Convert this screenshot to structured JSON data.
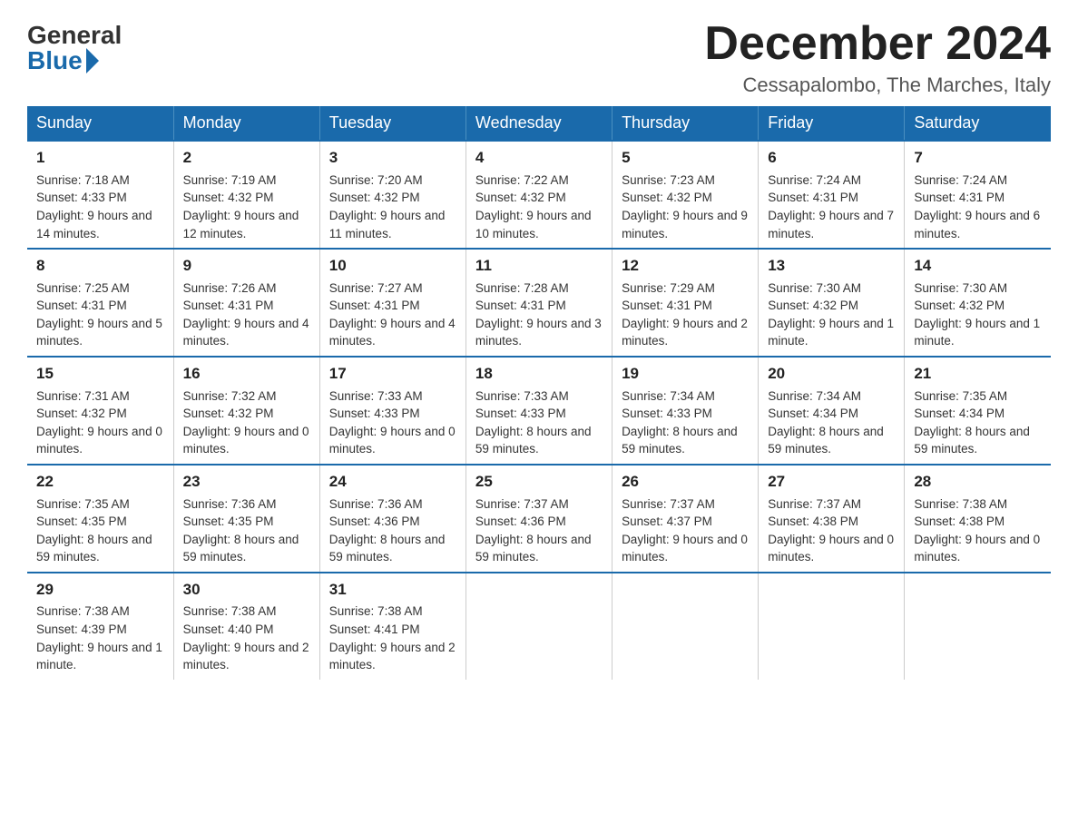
{
  "header": {
    "logo_general": "General",
    "logo_blue": "Blue",
    "month_year": "December 2024",
    "location": "Cessapalombo, The Marches, Italy"
  },
  "weekdays": [
    "Sunday",
    "Monday",
    "Tuesday",
    "Wednesday",
    "Thursday",
    "Friday",
    "Saturday"
  ],
  "weeks": [
    [
      {
        "day": "1",
        "sunrise": "7:18 AM",
        "sunset": "4:33 PM",
        "daylight": "9 hours and 14 minutes."
      },
      {
        "day": "2",
        "sunrise": "7:19 AM",
        "sunset": "4:32 PM",
        "daylight": "9 hours and 12 minutes."
      },
      {
        "day": "3",
        "sunrise": "7:20 AM",
        "sunset": "4:32 PM",
        "daylight": "9 hours and 11 minutes."
      },
      {
        "day": "4",
        "sunrise": "7:22 AM",
        "sunset": "4:32 PM",
        "daylight": "9 hours and 10 minutes."
      },
      {
        "day": "5",
        "sunrise": "7:23 AM",
        "sunset": "4:32 PM",
        "daylight": "9 hours and 9 minutes."
      },
      {
        "day": "6",
        "sunrise": "7:24 AM",
        "sunset": "4:31 PM",
        "daylight": "9 hours and 7 minutes."
      },
      {
        "day": "7",
        "sunrise": "7:24 AM",
        "sunset": "4:31 PM",
        "daylight": "9 hours and 6 minutes."
      }
    ],
    [
      {
        "day": "8",
        "sunrise": "7:25 AM",
        "sunset": "4:31 PM",
        "daylight": "9 hours and 5 minutes."
      },
      {
        "day": "9",
        "sunrise": "7:26 AM",
        "sunset": "4:31 PM",
        "daylight": "9 hours and 4 minutes."
      },
      {
        "day": "10",
        "sunrise": "7:27 AM",
        "sunset": "4:31 PM",
        "daylight": "9 hours and 4 minutes."
      },
      {
        "day": "11",
        "sunrise": "7:28 AM",
        "sunset": "4:31 PM",
        "daylight": "9 hours and 3 minutes."
      },
      {
        "day": "12",
        "sunrise": "7:29 AM",
        "sunset": "4:31 PM",
        "daylight": "9 hours and 2 minutes."
      },
      {
        "day": "13",
        "sunrise": "7:30 AM",
        "sunset": "4:32 PM",
        "daylight": "9 hours and 1 minute."
      },
      {
        "day": "14",
        "sunrise": "7:30 AM",
        "sunset": "4:32 PM",
        "daylight": "9 hours and 1 minute."
      }
    ],
    [
      {
        "day": "15",
        "sunrise": "7:31 AM",
        "sunset": "4:32 PM",
        "daylight": "9 hours and 0 minutes."
      },
      {
        "day": "16",
        "sunrise": "7:32 AM",
        "sunset": "4:32 PM",
        "daylight": "9 hours and 0 minutes."
      },
      {
        "day": "17",
        "sunrise": "7:33 AM",
        "sunset": "4:33 PM",
        "daylight": "9 hours and 0 minutes."
      },
      {
        "day": "18",
        "sunrise": "7:33 AM",
        "sunset": "4:33 PM",
        "daylight": "8 hours and 59 minutes."
      },
      {
        "day": "19",
        "sunrise": "7:34 AM",
        "sunset": "4:33 PM",
        "daylight": "8 hours and 59 minutes."
      },
      {
        "day": "20",
        "sunrise": "7:34 AM",
        "sunset": "4:34 PM",
        "daylight": "8 hours and 59 minutes."
      },
      {
        "day": "21",
        "sunrise": "7:35 AM",
        "sunset": "4:34 PM",
        "daylight": "8 hours and 59 minutes."
      }
    ],
    [
      {
        "day": "22",
        "sunrise": "7:35 AM",
        "sunset": "4:35 PM",
        "daylight": "8 hours and 59 minutes."
      },
      {
        "day": "23",
        "sunrise": "7:36 AM",
        "sunset": "4:35 PM",
        "daylight": "8 hours and 59 minutes."
      },
      {
        "day": "24",
        "sunrise": "7:36 AM",
        "sunset": "4:36 PM",
        "daylight": "8 hours and 59 minutes."
      },
      {
        "day": "25",
        "sunrise": "7:37 AM",
        "sunset": "4:36 PM",
        "daylight": "8 hours and 59 minutes."
      },
      {
        "day": "26",
        "sunrise": "7:37 AM",
        "sunset": "4:37 PM",
        "daylight": "9 hours and 0 minutes."
      },
      {
        "day": "27",
        "sunrise": "7:37 AM",
        "sunset": "4:38 PM",
        "daylight": "9 hours and 0 minutes."
      },
      {
        "day": "28",
        "sunrise": "7:38 AM",
        "sunset": "4:38 PM",
        "daylight": "9 hours and 0 minutes."
      }
    ],
    [
      {
        "day": "29",
        "sunrise": "7:38 AM",
        "sunset": "4:39 PM",
        "daylight": "9 hours and 1 minute."
      },
      {
        "day": "30",
        "sunrise": "7:38 AM",
        "sunset": "4:40 PM",
        "daylight": "9 hours and 2 minutes."
      },
      {
        "day": "31",
        "sunrise": "7:38 AM",
        "sunset": "4:41 PM",
        "daylight": "9 hours and 2 minutes."
      },
      null,
      null,
      null,
      null
    ]
  ]
}
